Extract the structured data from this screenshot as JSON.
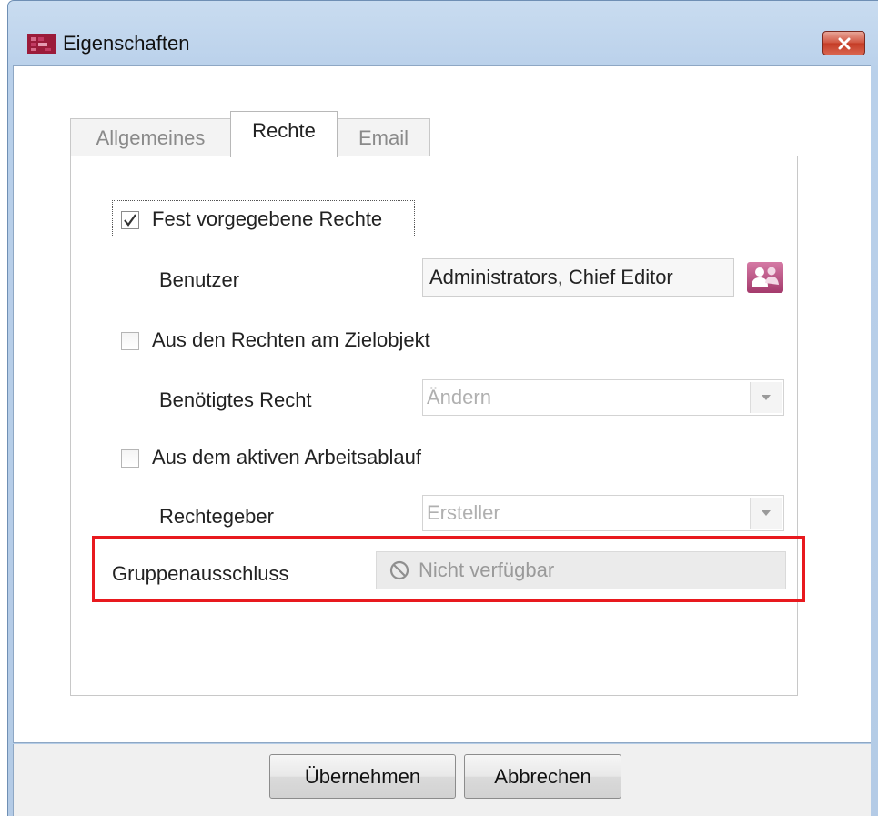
{
  "window": {
    "title": "Eigenschaften",
    "close_icon": "close-icon"
  },
  "tabs": [
    {
      "label": "Allgemeines",
      "active": false
    },
    {
      "label": "Rechte",
      "active": true
    },
    {
      "label": "Email",
      "active": false
    }
  ],
  "rights": {
    "fixed": {
      "label": "Fest vorgegebene Rechte",
      "checked": true
    },
    "user": {
      "label": "Benutzer",
      "value": "Administrators, Chief Editor",
      "button_icon": "users-icon"
    },
    "from_target": {
      "label": "Aus den Rechten am Zielobjekt",
      "checked": false
    },
    "required_right": {
      "label": "Benötigtes Recht",
      "selected": "Ändern"
    },
    "from_workflow": {
      "label": "Aus dem aktiven Arbeitsablauf",
      "checked": false
    },
    "rights_giver": {
      "label": "Rechtegeber",
      "selected": "Ersteller"
    },
    "group_exclusion": {
      "label": "Gruppenausschluss",
      "value": "Nicht verfügbar",
      "icon": "not-available-icon"
    }
  },
  "buttons": {
    "apply": "Übernehmen",
    "cancel": "Abbrechen"
  },
  "colors": {
    "highlight": "#e8191e",
    "app_icon": "#9b1b3a",
    "users_button": "#b2457a"
  }
}
